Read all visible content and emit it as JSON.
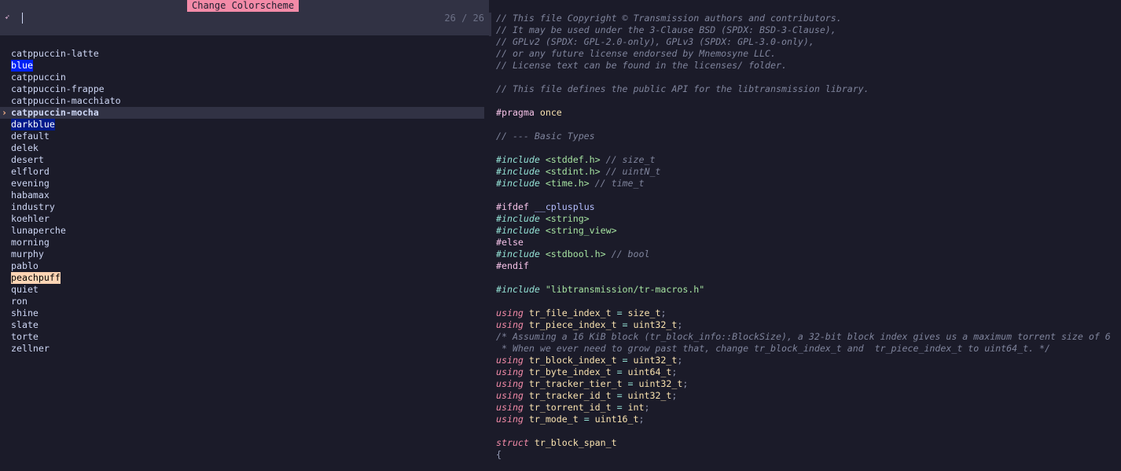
{
  "picker": {
    "title": "Change Colorscheme",
    "query": "",
    "count": "26 / 26",
    "selected_index": 5,
    "items": [
      {
        "label": "catppuccin-latte",
        "hl": ""
      },
      {
        "label": "blue",
        "hl": "hl-blue"
      },
      {
        "label": "catppuccin",
        "hl": ""
      },
      {
        "label": "catppuccin-frappe",
        "hl": ""
      },
      {
        "label": "catppuccin-macchiato",
        "hl": ""
      },
      {
        "label": "catppuccin-mocha",
        "hl": ""
      },
      {
        "label": "darkblue",
        "hl": "hl-darkblue"
      },
      {
        "label": "default",
        "hl": ""
      },
      {
        "label": "delek",
        "hl": ""
      },
      {
        "label": "desert",
        "hl": ""
      },
      {
        "label": "elflord",
        "hl": ""
      },
      {
        "label": "evening",
        "hl": ""
      },
      {
        "label": "habamax",
        "hl": ""
      },
      {
        "label": "industry",
        "hl": ""
      },
      {
        "label": "koehler",
        "hl": ""
      },
      {
        "label": "lunaperche",
        "hl": ""
      },
      {
        "label": "morning",
        "hl": ""
      },
      {
        "label": "murphy",
        "hl": ""
      },
      {
        "label": "pablo",
        "hl": ""
      },
      {
        "label": "peachpuff",
        "hl": "hl-peach"
      },
      {
        "label": "quiet",
        "hl": ""
      },
      {
        "label": "ron",
        "hl": ""
      },
      {
        "label": "shine",
        "hl": ""
      },
      {
        "label": "slate",
        "hl": ""
      },
      {
        "label": "torte",
        "hl": ""
      },
      {
        "label": "zellner",
        "hl": ""
      }
    ]
  },
  "editor": {
    "lines": [
      [
        [
          "// This file Copyright © Transmission authors and contributors.",
          "c"
        ]
      ],
      [
        [
          "// It may be used under the 3-Clause BSD (SPDX: BSD-3-Clause),",
          "c"
        ]
      ],
      [
        [
          "// GPLv2 (SPDX: GPL-2.0-only), GPLv3 (SPDX: GPL-3.0-only),",
          "c"
        ]
      ],
      [
        [
          "// or any future license endorsed by Mnemosyne LLC.",
          "c"
        ]
      ],
      [
        [
          "// License text can be found in the licenses/ folder.",
          "c"
        ]
      ],
      [],
      [
        [
          "// This file defines the public API for the libtransmission library.",
          "c"
        ]
      ],
      [],
      [
        [
          "#pragma",
          "pp"
        ],
        [
          " ",
          "id"
        ],
        [
          "once",
          "once"
        ]
      ],
      [],
      [
        [
          "// --- Basic Types",
          "c"
        ]
      ],
      [],
      [
        [
          "#include",
          "inc"
        ],
        [
          " <stddef.h>",
          "str"
        ],
        [
          " // size_t",
          "c"
        ]
      ],
      [
        [
          "#include",
          "inc"
        ],
        [
          " <stdint.h>",
          "str"
        ],
        [
          " // uintN_t",
          "c"
        ]
      ],
      [
        [
          "#include",
          "inc"
        ],
        [
          " <time.h>",
          "str"
        ],
        [
          " // time_t",
          "c"
        ]
      ],
      [],
      [
        [
          "#ifdef",
          "pp"
        ],
        [
          " __cplusplus",
          "mac"
        ]
      ],
      [
        [
          "#include",
          "inc"
        ],
        [
          " <string>",
          "str"
        ]
      ],
      [
        [
          "#include",
          "inc"
        ],
        [
          " <string_view>",
          "str"
        ]
      ],
      [
        [
          "#else",
          "pp"
        ]
      ],
      [
        [
          "#include",
          "inc"
        ],
        [
          " <stdbool.h>",
          "str"
        ],
        [
          " // bool",
          "c"
        ]
      ],
      [
        [
          "#endif",
          "pp"
        ]
      ],
      [],
      [
        [
          "#include",
          "inc"
        ],
        [
          " \"libtransmission/tr-macros.h\"",
          "str"
        ]
      ],
      [],
      [
        [
          "using",
          "kw"
        ],
        [
          " tr_file_index_t ",
          "ty"
        ],
        [
          "=",
          "op"
        ],
        [
          " size_t",
          "ty"
        ],
        [
          ";",
          "pn"
        ]
      ],
      [
        [
          "using",
          "kw"
        ],
        [
          " tr_piece_index_t ",
          "ty"
        ],
        [
          "=",
          "op"
        ],
        [
          " uint32_t",
          "ty"
        ],
        [
          ";",
          "pn"
        ]
      ],
      [
        [
          "/* Assuming a 16 KiB block (tr_block_info::BlockSize), a 32-bit block index gives us a maximum torrent size of 6",
          "c"
        ]
      ],
      [
        [
          " * When we ever need to grow past that, change tr_block_index_t and  tr_piece_index_t to uint64_t. */",
          "c"
        ]
      ],
      [
        [
          "using",
          "kw"
        ],
        [
          " tr_block_index_t ",
          "ty"
        ],
        [
          "=",
          "op"
        ],
        [
          " uint32_t",
          "ty"
        ],
        [
          ";",
          "pn"
        ]
      ],
      [
        [
          "using",
          "kw"
        ],
        [
          " tr_byte_index_t ",
          "ty"
        ],
        [
          "=",
          "op"
        ],
        [
          " uint64_t",
          "ty"
        ],
        [
          ";",
          "pn"
        ]
      ],
      [
        [
          "using",
          "kw"
        ],
        [
          " tr_tracker_tier_t ",
          "ty"
        ],
        [
          "=",
          "op"
        ],
        [
          " uint32_t",
          "ty"
        ],
        [
          ";",
          "pn"
        ]
      ],
      [
        [
          "using",
          "kw"
        ],
        [
          " tr_tracker_id_t ",
          "ty"
        ],
        [
          "=",
          "op"
        ],
        [
          " uint32_t",
          "ty"
        ],
        [
          ";",
          "pn"
        ]
      ],
      [
        [
          "using",
          "kw"
        ],
        [
          " tr_torrent_id_t ",
          "ty"
        ],
        [
          "=",
          "op"
        ],
        [
          " int",
          "ty"
        ],
        [
          ";",
          "pn"
        ]
      ],
      [
        [
          "using",
          "kw"
        ],
        [
          " tr_mode_t ",
          "ty"
        ],
        [
          "=",
          "op"
        ],
        [
          " uint16_t",
          "ty"
        ],
        [
          ";",
          "pn"
        ]
      ],
      [],
      [
        [
          "struct",
          "kw"
        ],
        [
          " tr_block_span_t",
          "ty"
        ]
      ],
      [
        [
          "{",
          "pn"
        ]
      ]
    ]
  }
}
